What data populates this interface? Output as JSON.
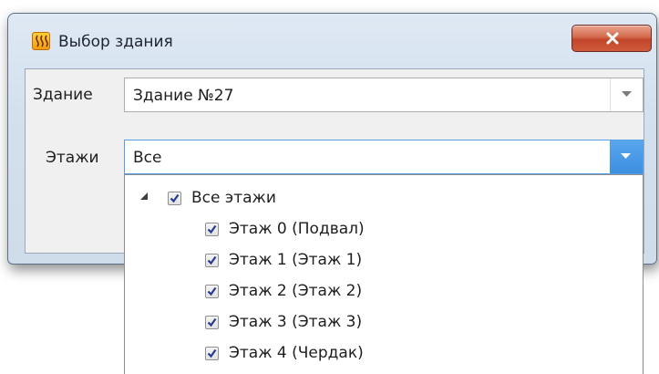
{
  "window": {
    "title": "Выбор здания",
    "app_icon": "heater-icon",
    "close_icon": "close-icon"
  },
  "form": {
    "building_label": "Здание",
    "building_value": "Здание №27",
    "floors_label": "Этажи",
    "floors_value": "Все"
  },
  "floors_tree": {
    "root": {
      "label": "Все этажи",
      "checked": true,
      "expanded": true
    },
    "items": [
      {
        "label": "Этаж 0 (Подвал)",
        "checked": true
      },
      {
        "label": "Этаж 1 (Этаж 1)",
        "checked": true
      },
      {
        "label": "Этаж 2 (Этаж 2)",
        "checked": true
      },
      {
        "label": "Этаж 3 (Этаж 3)",
        "checked": true
      },
      {
        "label": "Этаж 4 (Чердак)",
        "checked": true
      }
    ]
  },
  "colors": {
    "close_button": "#c9533a",
    "combo_focus": "#569de5",
    "checkmark": "#2a3a8f"
  }
}
